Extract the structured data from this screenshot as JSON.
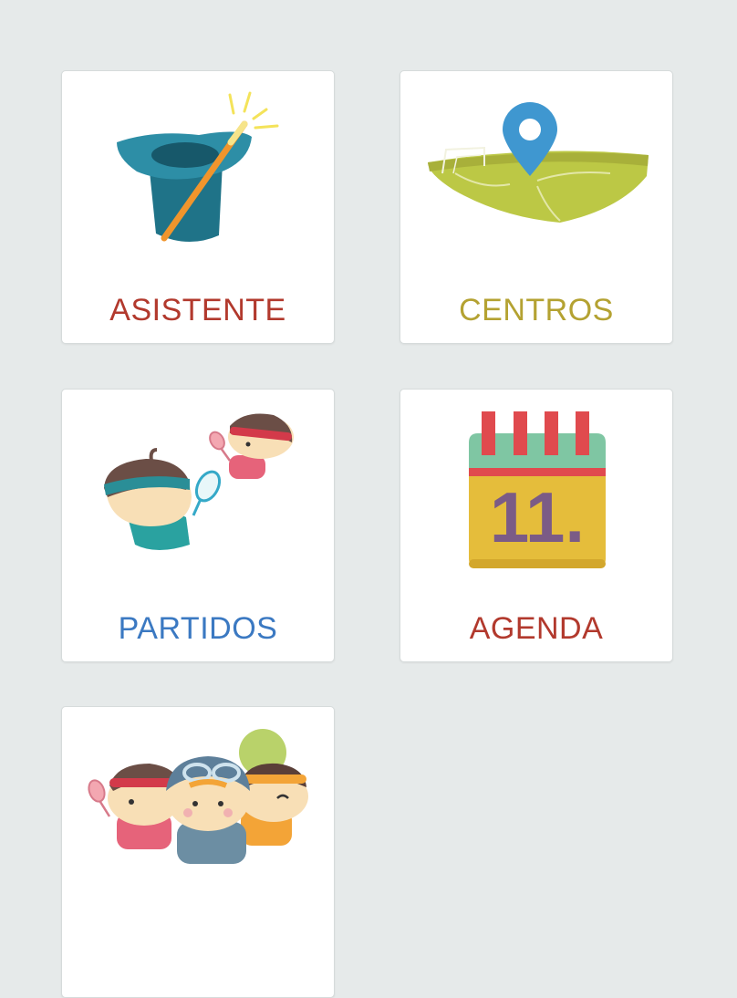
{
  "tiles": [
    {
      "key": "asistente",
      "label": "ASISTENTE",
      "icon": "magic-hat-icon",
      "color": "#b2392d"
    },
    {
      "key": "centros",
      "label": "CENTROS",
      "icon": "field-location-icon",
      "color": "#b4a232"
    },
    {
      "key": "partidos",
      "label": "PARTIDOS",
      "icon": "tennis-players-icon",
      "color": "#3b79c2"
    },
    {
      "key": "agenda",
      "label": "AGENDA",
      "icon": "calendar-icon",
      "color": "#b2392d",
      "calendar_day": "11."
    },
    {
      "key": "grupo",
      "label": "",
      "icon": "group-kids-icon",
      "color": "#3b79c2"
    }
  ]
}
